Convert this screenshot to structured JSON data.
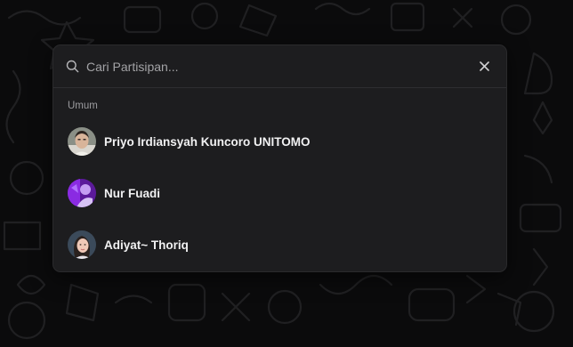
{
  "search": {
    "placeholder": "Cari Partisipan...",
    "value": ""
  },
  "section": {
    "label": "Umum"
  },
  "participants": [
    {
      "name": "Priyo Irdiansyah Kuncoro UNITOMO",
      "avatar_icon": "person-photo-avatar"
    },
    {
      "name": "Nur Fuadi",
      "avatar_icon": "purple-photo-avatar"
    },
    {
      "name": "Adiyat~ Thoriq",
      "avatar_icon": "person-photo-avatar"
    }
  ],
  "colors": {
    "background": "#0b0b0c",
    "panel": "#1d1d1f",
    "text": "#f1f1f2",
    "muted": "#9b9b9e"
  }
}
